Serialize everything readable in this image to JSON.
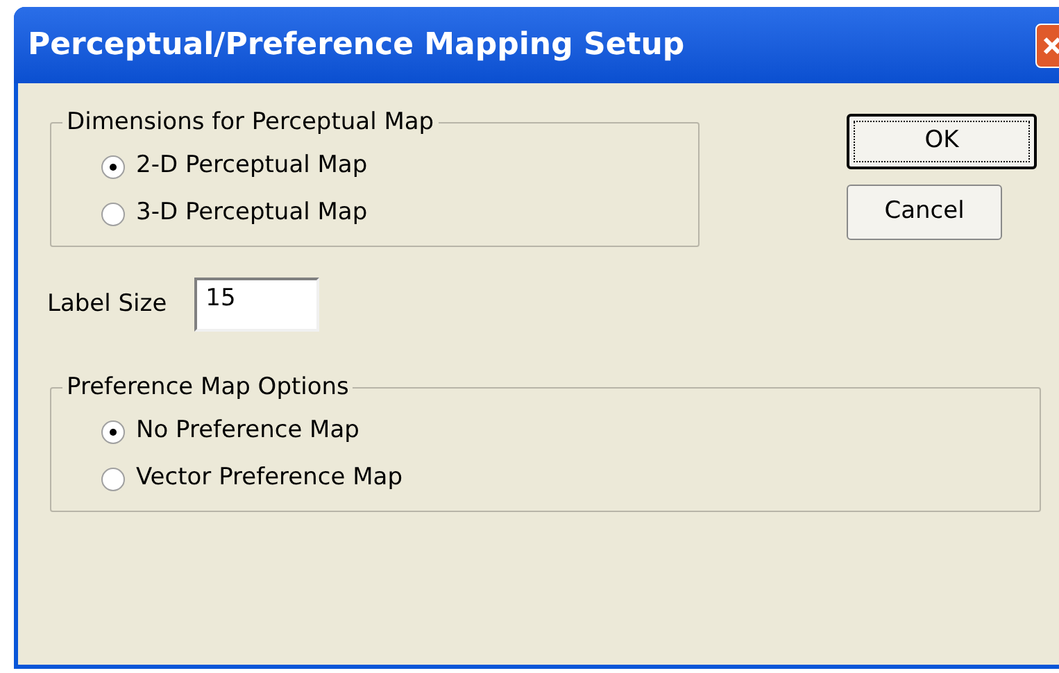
{
  "window": {
    "title": "Perceptual/Preference Mapping Setup"
  },
  "dimensions": {
    "label": "Dimensions for Perceptual Map",
    "options": [
      {
        "label": "2-D Perceptual Map",
        "selected": true
      },
      {
        "label": "3-D Perceptual Map",
        "selected": false
      }
    ]
  },
  "label_size": {
    "label": "Label Size",
    "value": "15"
  },
  "preference": {
    "label": "Preference Map Options",
    "options": [
      {
        "label": "No Preference Map",
        "selected": true
      },
      {
        "label": "Vector Preference Map",
        "selected": false
      }
    ]
  },
  "buttons": [
    {
      "label": "OK",
      "default": true
    },
    {
      "label": "Cancel",
      "default": false
    }
  ]
}
